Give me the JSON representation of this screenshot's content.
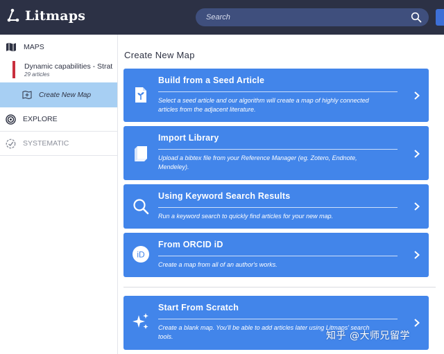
{
  "app": {
    "name": "Litmaps"
  },
  "search": {
    "placeholder": "Search"
  },
  "sidebar": {
    "maps_label": "MAPS",
    "current_map": {
      "title": "Dynamic capabilities - Strat",
      "count": "29 articles"
    },
    "create_label": "Create New Map",
    "explore_label": "EXPLORE",
    "systematic_label": "SYSTEMATIC"
  },
  "main": {
    "title": "Create New Map",
    "cards": [
      {
        "icon": "seed-article-icon",
        "title": "Build from a Seed Article",
        "desc_lines": [
          "Select a seed article and our algorithm will create a map of highly connected",
          "articles from the adjacent literature."
        ]
      },
      {
        "icon": "library-book-icon",
        "title": "Import Library",
        "desc_lines": [
          "Upload a bibtex file from your Reference Manager (eg. Zotero, Endnote,",
          "Mendeley)."
        ]
      },
      {
        "icon": "magnifier-icon",
        "title": "Using Keyword Search Results",
        "desc_lines": [
          "Run a keyword search to quickly find articles for your new map."
        ]
      },
      {
        "icon": "orcid-icon",
        "title": "From ORCID iD",
        "desc_lines": [
          "Create a map from all of an author's works."
        ]
      },
      {
        "icon": "sparkles-icon",
        "title": "Start From Scratch",
        "desc_lines": [
          "Create a blank map. You'll be able to add articles later using Litmaps' search",
          "tools."
        ]
      }
    ],
    "orcid_badge": "iD"
  },
  "watermark": "知乎 @大师兄留学",
  "colors": {
    "topbar": "#2c3145",
    "card": "#4285ea",
    "sidebar_active": "#a7cff3",
    "map_marker": "#c9303e"
  }
}
